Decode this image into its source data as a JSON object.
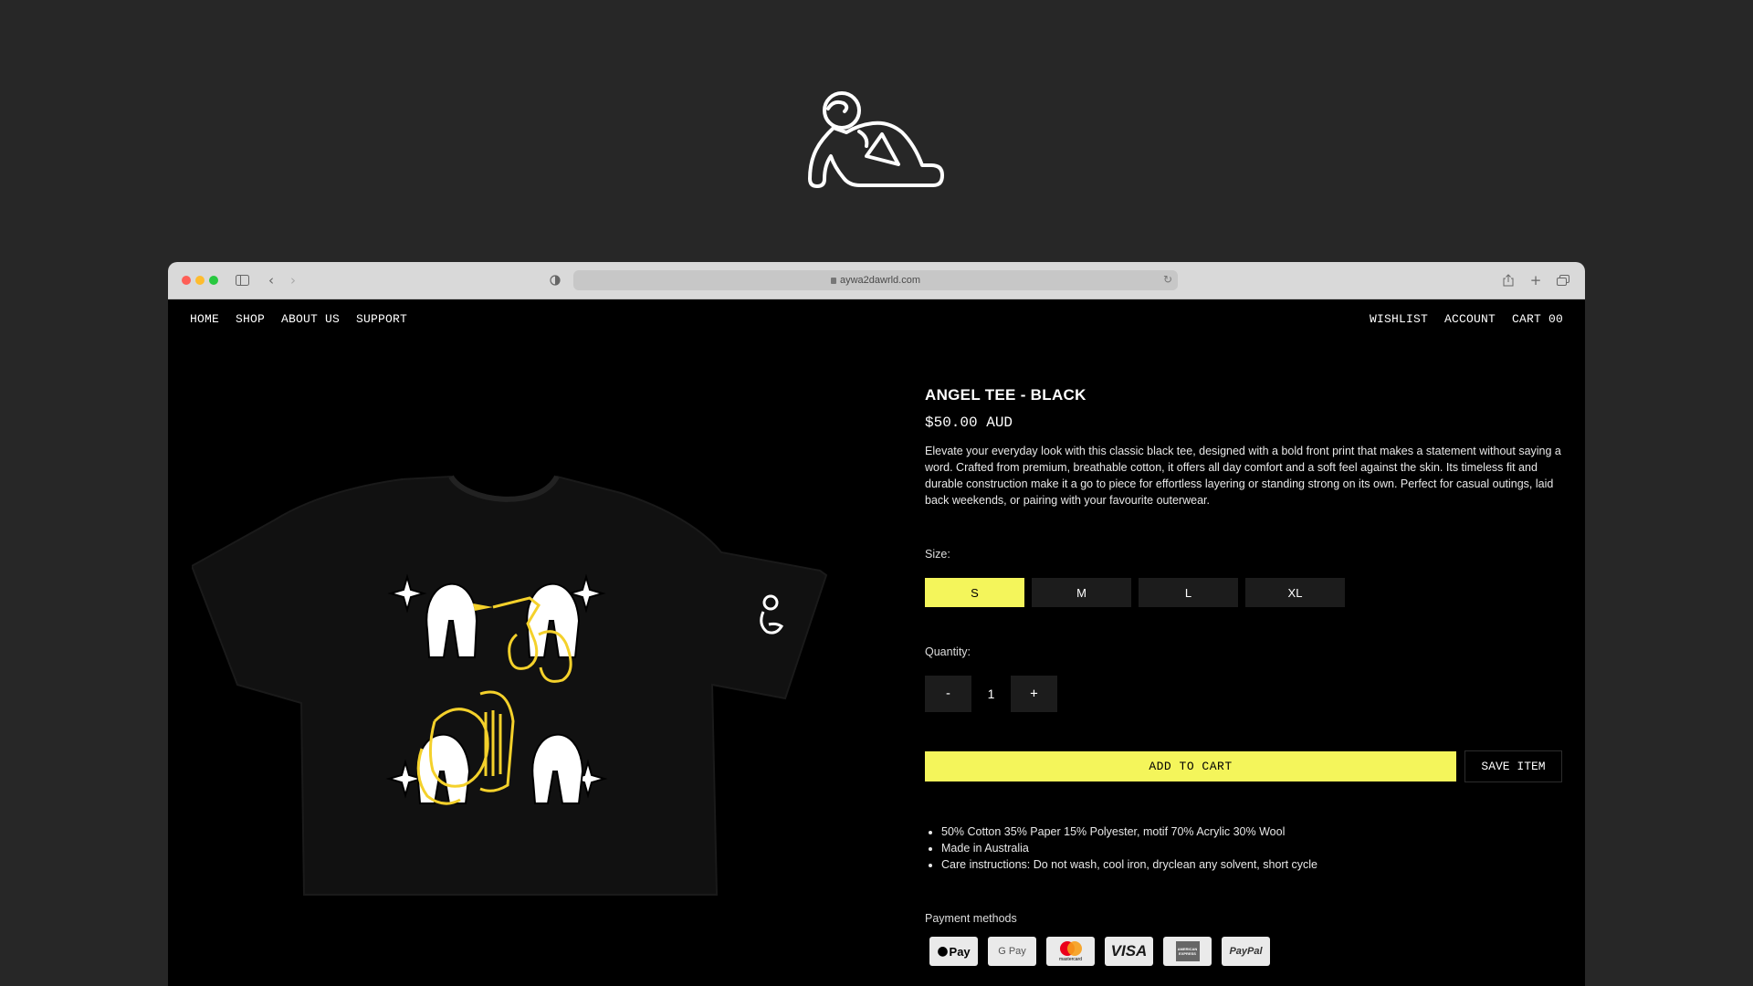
{
  "browser": {
    "url": "aywa2dawrld.com"
  },
  "nav": {
    "left": [
      "HOME",
      "SHOP",
      "ABOUT US",
      "SUPPORT"
    ],
    "right": [
      "WISHLIST",
      "ACCOUNT",
      "CART 00"
    ]
  },
  "product": {
    "title": "ANGEL TEE - BLACK",
    "price": "$50.00 AUD",
    "description": "Elevate your everyday look with this classic black tee, designed with a bold front print that makes a statement without saying a word. Crafted from premium, breathable cotton, it offers all day comfort and a soft feel against the skin. Its timeless fit and durable construction make it a go to piece for effortless layering or standing strong on its own. Perfect for casual outings, laid back weekends, or pairing with your favourite outerwear.",
    "size_label": "Size:",
    "sizes": [
      "S",
      "M",
      "L",
      "XL"
    ],
    "selected_size": "S",
    "quantity_label": "Quantity:",
    "quantity": "1",
    "minus": "-",
    "plus": "+",
    "add_to_cart": "ADD TO CART",
    "save_item": "SAVE ITEM",
    "specs": [
      "50% Cotton 35% Paper 15% Polyester, motif 70% Acrylic 30% Wool",
      "Made in Australia",
      "Care instructions: Do not wash, cool iron, dryclean any solvent, short cycle"
    ],
    "payment_label": "Payment methods",
    "payment_methods": [
      "Pay",
      "G Pay",
      "mastercard",
      "VISA",
      "AMERICAN EXPRESS",
      "PayPal"
    ]
  },
  "colors": {
    "accent": "#f4f55b",
    "page_bg": "#272727",
    "site_bg": "#000000"
  }
}
